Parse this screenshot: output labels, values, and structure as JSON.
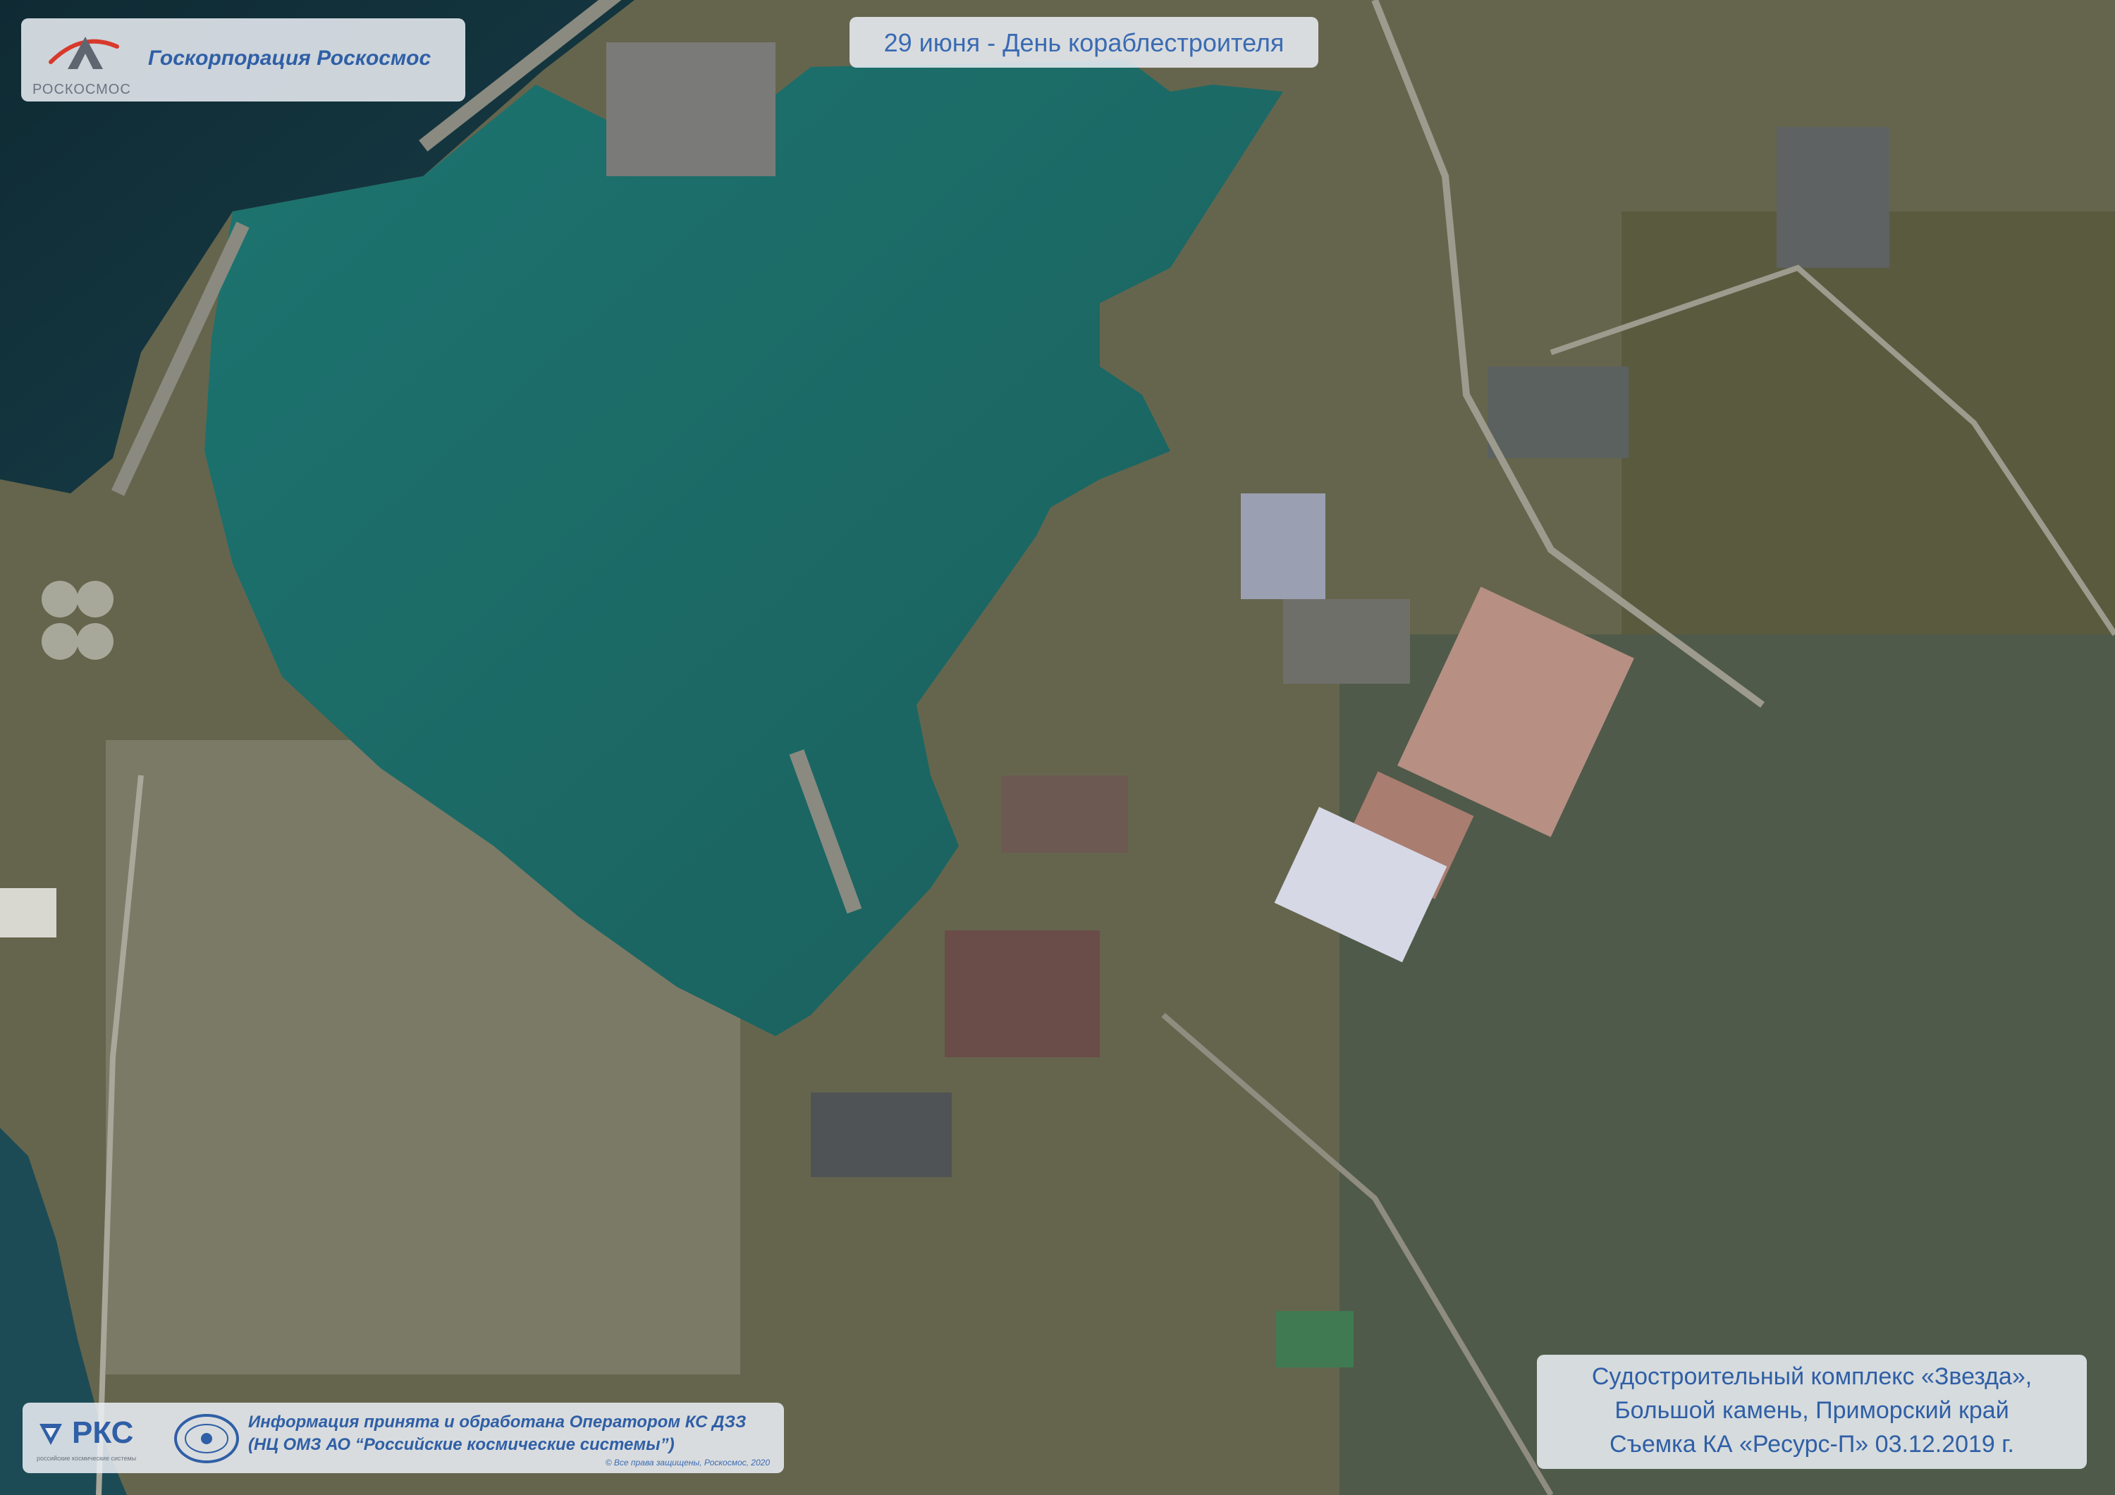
{
  "header": {
    "logo_caption": "РОСКОСМОС",
    "org_name": "Госкорпорация Роскосмос",
    "date_text": "29 июня - День кораблестроителя"
  },
  "credit": {
    "rks_label": "РКС",
    "rks_subtitle": "российские космические системы",
    "line1": "Информация принята и обработана Оператором КС ДЗЗ",
    "line2": "(НЦ ОМЗ АО “Российские космические системы”)",
    "copyright": "© Все права защищены, Роскосмос, 2020"
  },
  "caption": {
    "line1": "Судостроительный комплекс «Звезда»,",
    "line2": "Большой камень, Приморский край",
    "line3": "Съемка КА «Ресурс-П» 03.12.2019 г."
  },
  "colors": {
    "accent_text": "#2f5fa6",
    "logo_red": "#d8392b",
    "bay_water": "#1d6b66",
    "open_sea": "#13333b",
    "land": "#6b6c52"
  }
}
